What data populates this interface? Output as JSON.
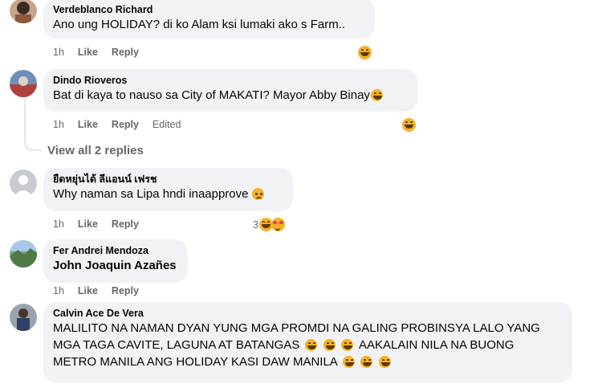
{
  "comments": [
    {
      "author": "Verdeblanco Richard",
      "text": "Ano ung HOLIDAY? di ko Alam ksi lumaki ako s Farm..",
      "time": "1h",
      "like": "Like",
      "reply": "Reply",
      "reaction": "laugh-emoji"
    },
    {
      "author": "Dindo Rioveros",
      "text": "Bat di kaya to nauso sa City of MAKATI? Mayor Abby Binay",
      "time": "1h",
      "like": "Like",
      "reply": "Reply",
      "edited": "Edited",
      "reaction": "laugh-emoji"
    },
    {
      "author": "ยืดหยุ่นได้ ลีแอนน์ เฟรช",
      "text": "Why naman sa Lipa hndi inaapprove",
      "time": "1h",
      "like": "Like",
      "reply": "Reply",
      "reaction_count": "3"
    },
    {
      "author": "Fer Andrei Mendoza",
      "text": "John Joaquin Azañes",
      "time": "1h",
      "like": "Like",
      "reply": "Reply"
    },
    {
      "author": "Calvin Ace De Vera",
      "text_lines": [
        "MALILITO NA NAMAN DYAN YUNG MGA PROMDI NA GALING PROBINSYA LALO YANG",
        "MGA TAGA CAVITE, LAGUNA AT BATANGAS",
        "AAKALAIN NILA NA BUONG",
        "METRO MANILA ANG HOLIDAY KASI DAW MANILA"
      ]
    }
  ],
  "view_replies": "View all 2 replies",
  "colors": {
    "bubble": "#f0f2f5",
    "meta": "#65676b",
    "text": "#050505",
    "emoji": "#f7b125"
  }
}
